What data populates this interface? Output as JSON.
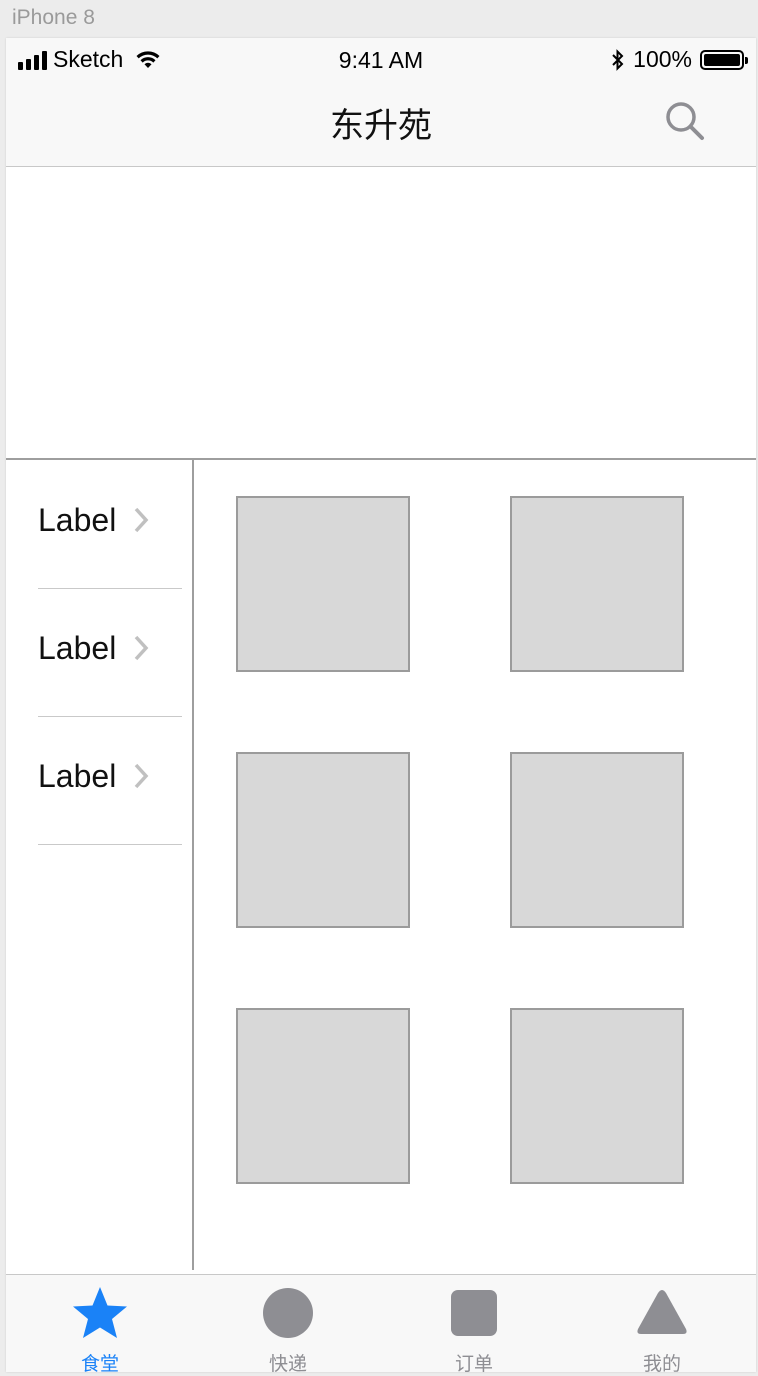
{
  "artboard": {
    "title": "iPhone 8"
  },
  "status_bar": {
    "carrier": "Sketch",
    "time": "9:41 AM",
    "battery": "100%",
    "icons": [
      "signal-icon",
      "wifi-icon",
      "bluetooth-icon",
      "battery-icon"
    ],
    "battery_level": 1.0
  },
  "nav": {
    "title": "东升苑",
    "search_icon": "search-icon"
  },
  "side_menu": {
    "items": [
      {
        "label": "Label"
      },
      {
        "label": "Label"
      },
      {
        "label": "Label"
      }
    ]
  },
  "grid": {
    "tile_count": 6,
    "tile_color": "#d8d8d8"
  },
  "tab_bar": {
    "active_color": "#1a82f7",
    "inactive_color": "#8e8e93",
    "tabs": [
      {
        "label": "食堂",
        "icon": "star-icon",
        "active": true
      },
      {
        "label": "快递",
        "icon": "circle-icon",
        "active": false
      },
      {
        "label": "订单",
        "icon": "square-icon",
        "active": false
      },
      {
        "label": "我的",
        "icon": "triangle-icon",
        "active": false
      }
    ]
  }
}
